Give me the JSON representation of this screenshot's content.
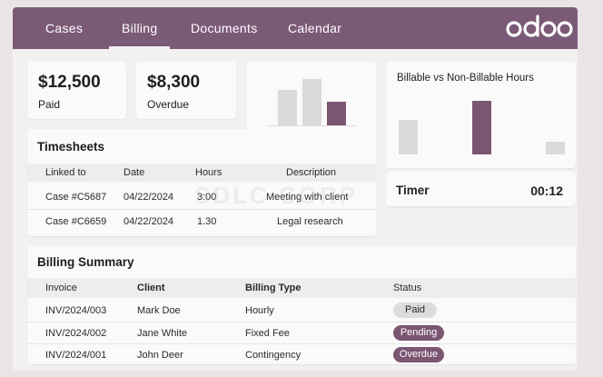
{
  "nav": {
    "tabs": [
      {
        "label": "Cases"
      },
      {
        "label": "Billing"
      },
      {
        "label": "Documents"
      },
      {
        "label": "Calendar"
      }
    ],
    "active_tab": "Billing",
    "logo_text": "odoo"
  },
  "kpis": {
    "paid": {
      "value": "$12,500",
      "label": "Paid"
    },
    "overdue": {
      "value": "$8,300",
      "label": "Overdue"
    }
  },
  "timesheets": {
    "title": "Timesheets",
    "columns": [
      "Linked to",
      "Date",
      "Hours",
      "Description"
    ],
    "rows": [
      [
        "Case #C5687",
        "04/22/2024",
        "3:00",
        "Meeting with client"
      ],
      [
        "Case #C6659",
        "04/22/2024",
        "1.30",
        "Legal research"
      ]
    ]
  },
  "chart_data": [
    {
      "type": "bar",
      "title": "",
      "categories": [
        "",
        "",
        ""
      ],
      "values": [
        45,
        60,
        30
      ],
      "ylim": [
        0,
        70
      ],
      "colors": [
        "#dcd9da",
        "#dcd9da",
        "#7b5673"
      ],
      "grid": false
    },
    {
      "type": "bar",
      "title": "Billable vs Non-Billable Hours",
      "categories": [
        "",
        "",
        ""
      ],
      "values": [
        38,
        59,
        14
      ],
      "ylim": [
        0,
        65
      ],
      "colors": [
        "#dcd9da",
        "#7b5673",
        "#dcd9da"
      ],
      "grid": false
    }
  ],
  "timer": {
    "label": "Timer",
    "value": "00:12"
  },
  "billing": {
    "title": "Billing Summary",
    "columns": [
      "Invoice",
      "Client",
      "Billing Type",
      "Status"
    ],
    "rows": [
      {
        "invoice": "INV/2024/003",
        "client": "Mark Doe",
        "type": "Hourly",
        "status": "Paid",
        "status_kind": "paid"
      },
      {
        "invoice": "INV/2024/002",
        "client": "Jane White",
        "type": "Fixed Fee",
        "status": "Pending",
        "status_kind": "pending"
      },
      {
        "invoice": "INV/2024/001",
        "client": "John Deer",
        "type": "Contingency",
        "status": "Overdue",
        "status_kind": "overdue"
      }
    ]
  },
  "colors": {
    "brand": "#7b5a78",
    "accent_bar": "#7b5673",
    "badge_paid_bg": "#dedbdc",
    "badge_status_bg": "#7b5673"
  },
  "watermark": "SDLC CORP"
}
